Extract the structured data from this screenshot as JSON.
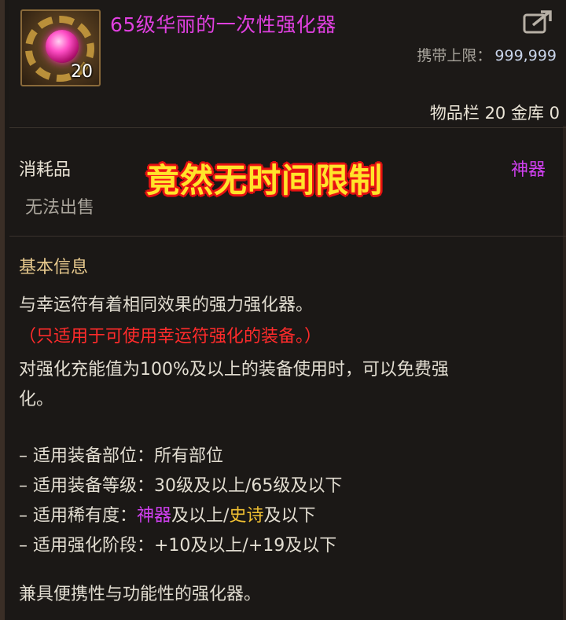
{
  "item": {
    "title": "65级华丽的一次性强化器",
    "stack_count": "20",
    "carry_limit_label": "携带上限：",
    "carry_limit_value": "999,999",
    "storage_info": "物品栏 20 金库 0",
    "type": "消耗品",
    "sell_status": "无法出售",
    "rarity": "神器"
  },
  "overlay": {
    "caption": "竟然无时间限制"
  },
  "info": {
    "section_title": "基本信息",
    "desc_line_1": "与幸运符有着相同效果的强力强化器。",
    "desc_line_2": "（只适用于可使用幸运符强化的装备。）",
    "desc_line_3": "对强化充能值为100%及以上的装备使用时，可以免费强",
    "desc_line_4": "化。",
    "slot_label": "– 适用装备部位：",
    "slot_value": "所有部位",
    "level_label": "– 适用装备等级：",
    "level_value": "30级及以上/65级及以下",
    "rarity_label": "– 适用稀有度：",
    "rarity_min": "神器",
    "rarity_mid": "及以上/",
    "rarity_max": "史诗",
    "rarity_end": "及以下",
    "enhance_label": "– 适用强化阶段：",
    "enhance_value": "+10及以上/+19及以下",
    "footer": "兼具便携性与功能性的强化器。"
  },
  "colors": {
    "title": "#e040e0",
    "rarity_artifact": "#d040f0",
    "rarity_epic": "#f0c032",
    "warning": "#ff2b2b",
    "section_title": "#e7c98d"
  },
  "icons": {
    "item_icon": "enhancer-orb-icon",
    "share_icon": "share-export-icon"
  }
}
